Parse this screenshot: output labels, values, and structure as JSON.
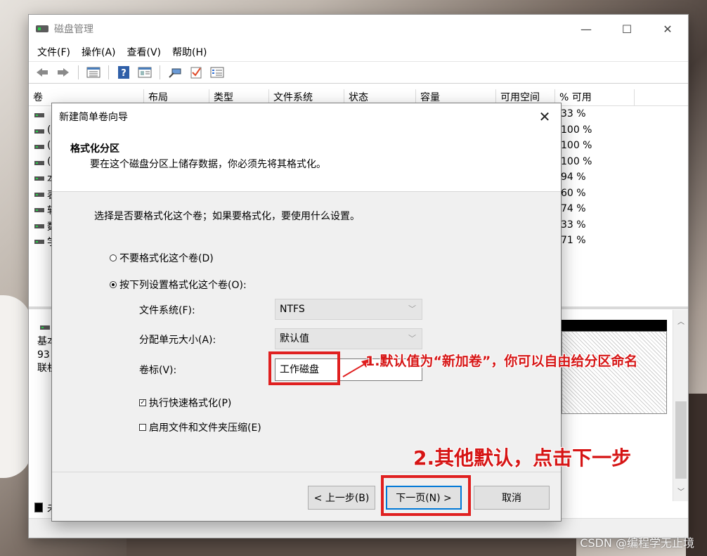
{
  "window": {
    "title": "磁盘管理",
    "controls": {
      "minimize": "—",
      "maximize": "☐",
      "close": "✕"
    }
  },
  "menu": [
    "文件(F)",
    "操作(A)",
    "查看(V)",
    "帮助(H)"
  ],
  "toolbar_icons": [
    "back-icon",
    "forward-icon",
    "list-view-icon",
    "help-icon",
    "properties-icon",
    "connect-icon",
    "check-icon",
    "list-icon"
  ],
  "volume_table": {
    "columns": [
      "卷",
      "布局",
      "类型",
      "文件系统",
      "状态",
      "容量",
      "可用空间",
      "% 可用"
    ],
    "rows": [
      {
        "letter": "",
        "pct": "33 %"
      },
      {
        "letter": "(",
        "pct": "100 %"
      },
      {
        "letter": "(",
        "pct": "100 %"
      },
      {
        "letter": "(",
        "pct": "100 %"
      },
      {
        "letter": "本",
        "pct": "94 %"
      },
      {
        "letter": "表",
        "pct": "60 %"
      },
      {
        "letter": "软",
        "pct": "74 %"
      },
      {
        "letter": "数",
        "pct": "33 %"
      },
      {
        "letter": "学",
        "pct": "71 %"
      }
    ]
  },
  "disk": {
    "line1": "基本",
    "line2": "93",
    "line3": "联机"
  },
  "legend": {
    "label": "未"
  },
  "dialog": {
    "title": "新建简单卷向导",
    "close": "✕",
    "heading": "格式化分区",
    "description": "要在这个磁盘分区上储存数据，你必须先将其格式化。",
    "question": "选择是否要格式化这个卷；如果要格式化，要使用什么设置。",
    "option_no_format": "不要格式化这个卷(D)",
    "option_format": "按下列设置格式化这个卷(O):",
    "fs_label": "文件系统(F):",
    "fs_value": "NTFS",
    "unit_label": "分配单元大小(A):",
    "unit_value": "默认值",
    "vol_label": "卷标(V):",
    "vol_value": "工作磁盘",
    "quick_format": "执行快速格式化(P)",
    "compression": "启用文件和文件夹压缩(E)",
    "back_button": "< 上一步(B)",
    "next_button": "下一页(N) >",
    "cancel_button": "取消"
  },
  "annotations": {
    "note1": "1.默认值为“新加卷”，你可以自由给分区命名",
    "note2": "2.其他默认，点击下一步",
    "color": "#e02020"
  },
  "watermark": "CSDN @编程学无止境"
}
